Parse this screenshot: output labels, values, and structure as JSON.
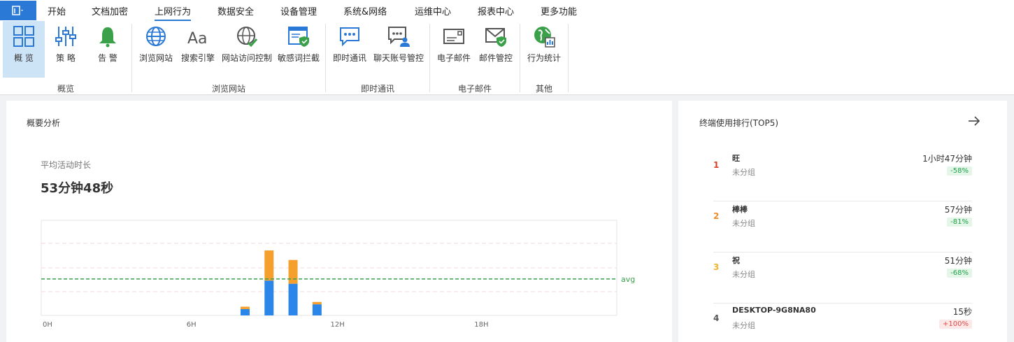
{
  "menu": {
    "items": [
      "开始",
      "文档加密",
      "上网行为",
      "数据安全",
      "设备管理",
      "系统&网络",
      "运维中心",
      "报表中心",
      "更多功能"
    ],
    "active": "上网行为"
  },
  "ribbon": {
    "buttons": [
      {
        "label": "概 览",
        "icon": "overview-grid-icon"
      },
      {
        "label": "策 略",
        "icon": "policy-sliders-icon"
      },
      {
        "label": "告 警",
        "icon": "alert-bell-icon"
      },
      {
        "label": "浏览网站",
        "icon": "globe-icon"
      },
      {
        "label": "搜索引擎",
        "icon": "search-engine-aa-icon"
      },
      {
        "label": "网站访问控制",
        "icon": "globe-check-icon"
      },
      {
        "label": "敏感词拦截",
        "icon": "browser-shield-icon"
      },
      {
        "label": "即时通讯",
        "icon": "chat-icon"
      },
      {
        "label": "聊天账号管控",
        "icon": "chat-user-icon"
      },
      {
        "label": "电子邮件",
        "icon": "mail-icon"
      },
      {
        "label": "邮件管控",
        "icon": "mail-shield-icon"
      },
      {
        "label": "行为统计",
        "icon": "globe-stats-icon"
      }
    ],
    "groups": [
      "概览",
      "浏览网站",
      "即时通讯",
      "电子邮件",
      "其他"
    ]
  },
  "overview": {
    "title": "概要分析",
    "avg_label": "平均活动时长",
    "avg_value": "53分钟48秒"
  },
  "chart_data": {
    "type": "bar",
    "stacked": true,
    "x_ticks": [
      "0H",
      "6H",
      "12H",
      "18H"
    ],
    "hours": [
      8,
      9,
      10,
      11
    ],
    "series": [
      {
        "color": "#2a86e8",
        "values": [
          8,
          44,
          40,
          14
        ]
      },
      {
        "color": "#f5a02c",
        "values": [
          3,
          38,
          30,
          3
        ]
      }
    ],
    "ylim": [
      0,
      120
    ],
    "avg_line": {
      "label": "avg",
      "value": 46,
      "color": "#3aa14a"
    },
    "grid_values": [
      30,
      60,
      91
    ]
  },
  "ranking": {
    "title": "终端使用排行(TOP5)",
    "rows": [
      {
        "rank": "1",
        "name": "旺",
        "group": "未分组",
        "time": "1小时47分钟",
        "change": "-58%",
        "trend": "down",
        "rank_color": "#d9412c"
      },
      {
        "rank": "2",
        "name": "棒棒",
        "group": "未分组",
        "time": "57分钟",
        "change": "-81%",
        "trend": "down",
        "rank_color": "#ef8a24"
      },
      {
        "rank": "3",
        "name": "祝",
        "group": "未分组",
        "time": "51分钟",
        "change": "-68%",
        "trend": "down",
        "rank_color": "#f2b42c"
      },
      {
        "rank": "4",
        "name": "DESKTOP-9G8NA80",
        "group": "未分组",
        "time": "15秒",
        "change": "+100%",
        "trend": "up",
        "rank_color": "#555555"
      }
    ]
  }
}
